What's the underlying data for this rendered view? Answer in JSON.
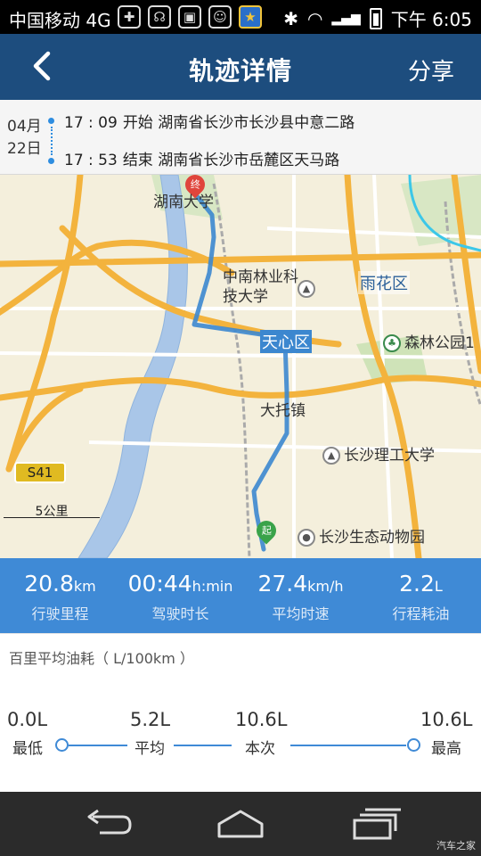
{
  "status_bar": {
    "carrier": "中国移动 4G",
    "network": "4G",
    "time": "下午 6:05"
  },
  "header": {
    "title": "轨迹详情",
    "share_label": "分享"
  },
  "trip": {
    "month": "04月",
    "day": "22日",
    "start": {
      "time": "17 : 09",
      "label": "开始",
      "address": "湖南省长沙市长沙县中意二路"
    },
    "end": {
      "time": "17 : 53",
      "label": "结束",
      "address": "湖南省长沙市岳麓区天马路"
    }
  },
  "map": {
    "labels": {
      "hunan_university": "湖南大学",
      "forestry_university": "中南林业科技大学",
      "forestry_university_line2": "",
      "yuhua": "雨花区",
      "tianxin": "天心区",
      "forest_park": "森林公园1",
      "datuo": "大托镇",
      "changsha_tech": "长沙理工大学",
      "zoo": "长沙生态动物园",
      "road_shield": "S41",
      "scale": "5公里",
      "start_pin": "起",
      "end_pin": "终"
    },
    "route_color": "#3c87cf"
  },
  "stats": [
    {
      "value": "20.8",
      "unit": "km",
      "label": "行驶里程"
    },
    {
      "value": "00:44",
      "unit": "h:min",
      "label": "驾驶时长"
    },
    {
      "value": "27.4",
      "unit": "km/h",
      "label": "平均时速"
    },
    {
      "value": "2.2",
      "unit": "L",
      "label": "行程耗油"
    }
  ],
  "fuel": {
    "heading": "百里平均油耗（ L/100km ）",
    "min": {
      "value": "0.0L",
      "label": "最低"
    },
    "avg": {
      "value": "5.2L",
      "label": "平均"
    },
    "current": {
      "value": "10.6L",
      "label": "本次"
    },
    "max": {
      "value": "10.6L",
      "label": "最高"
    }
  },
  "watermark": "汽车之家",
  "colors": {
    "header": "#1d4d7e",
    "accent": "#3f8ad6",
    "route": "#3c87cf"
  }
}
